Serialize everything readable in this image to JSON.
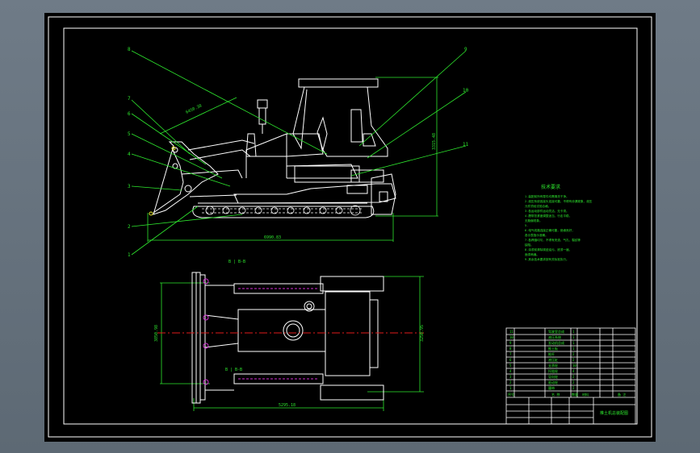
{
  "drawing": {
    "side_view": {
      "leader_numbers": [
        "8",
        "7",
        "6",
        "5",
        "4",
        "3",
        "2",
        "1",
        "9",
        "10",
        "11"
      ],
      "dimensions": {
        "blade_diag": "6450.38",
        "height_right": "3315.48",
        "overall_length": "6990.83"
      }
    },
    "plan_view": {
      "section_top": "B | B-B",
      "section_bottom": "B | B-B",
      "width_left": "3850.98",
      "width_right": "3250.95",
      "length_bottom": "5295.18"
    },
    "notes": {
      "title": "技术要求",
      "lines": [
        "1.装配前所有零件均需清洗干净。",
        "2.液压系统各接头连接可靠，不得有渗漏现象，液压",
        "  元件须经试验合格。",
        "3.各运动部件运动灵活，无卡滞。",
        "4.履带张紧度调整适当，行走平稳，",
        "  无跑偏现象。",
        "5.",
        "6.电气线路连接正确可靠，绝缘良好，",
        "  各仪表指示准确。",
        "7.各焊缝均匀，不得有夹渣、气孔、裂纹等",
        "  缺陷。",
        "8.涂漆前清除锈迹油污，底漆一遍，",
        "  面漆两遍。",
        "9.其余技术要求按有关标准执行。"
      ]
    },
    "title_block": {
      "rows": [
        {
          "no": "11",
          "name": "驾驶室总成",
          "qty": "1"
        },
        {
          "no": "10",
          "name": "液压系统",
          "qty": "1"
        },
        {
          "no": "9",
          "name": "发动机总成",
          "qty": "1"
        },
        {
          "no": "8",
          "name": "推土板",
          "qty": "1"
        },
        {
          "no": "7",
          "name": "推杆",
          "qty": "2"
        },
        {
          "no": "6",
          "name": "液压缸",
          "qty": "2"
        },
        {
          "no": "5",
          "name": "支承轮",
          "qty": "10"
        },
        {
          "no": "4",
          "name": "托链轮",
          "qty": "4"
        },
        {
          "no": "3",
          "name": "导向轮",
          "qty": "2"
        },
        {
          "no": "2",
          "name": "驱动轮",
          "qty": "2"
        },
        {
          "no": "1",
          "name": "履带",
          "qty": "2"
        }
      ],
      "header": {
        "no": "序号",
        "name": "名 称",
        "qty": "数量",
        "material": "材料",
        "remark": "备 注"
      },
      "drawing_title": "推土机总装配图"
    }
  },
  "colors": {
    "background": "#000000",
    "frame": "#ffffff",
    "annotation": "#2ee82e",
    "center_line": "#e01a1a",
    "hidden": "#d030d0",
    "highlight": "#e8e830"
  }
}
